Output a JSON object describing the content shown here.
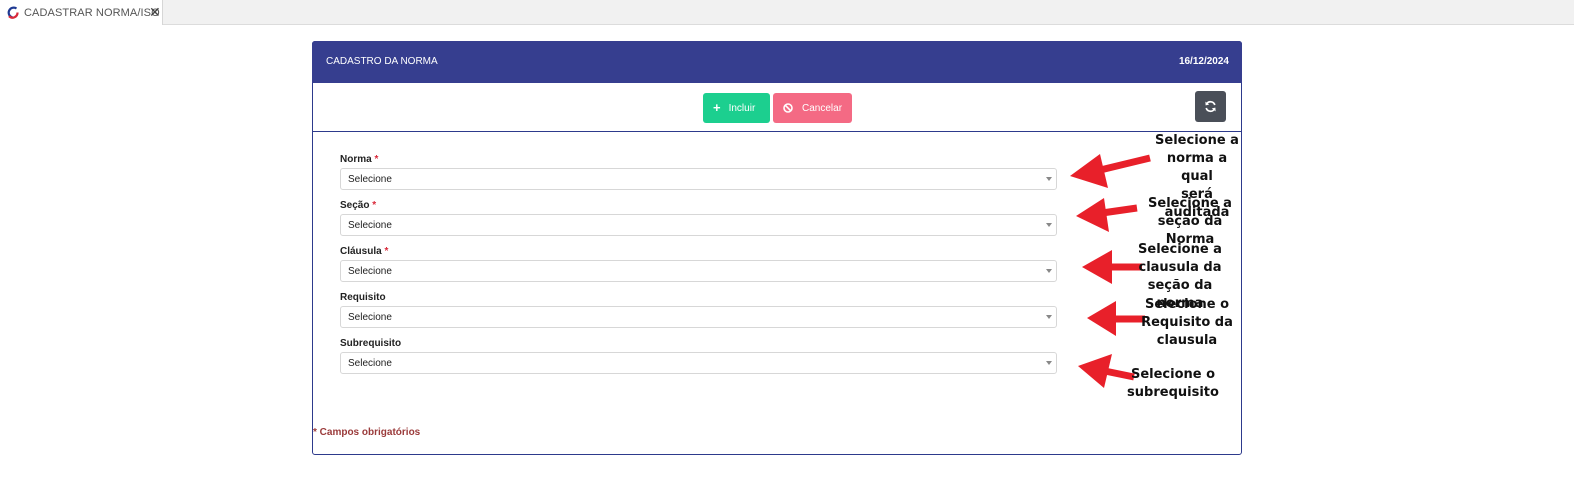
{
  "tab": {
    "title": "CADASTRAR NORMA/ISO",
    "close_symbol": "✕",
    "logo_icon": "app-logo-icon"
  },
  "panel": {
    "title": "CADASTRO DA NORMA",
    "date": "16/12/2024"
  },
  "toolbar": {
    "incluir_label": "Incluir",
    "incluir_icon": "plus-icon",
    "cancelar_label": "Cancelar",
    "cancelar_icon": "ban-icon",
    "refresh_icon": "refresh-icon",
    "incluir_color": "#1ccf8f",
    "cancelar_color": "#f46a84",
    "refresh_color": "#4a4f58"
  },
  "form": {
    "fields": [
      {
        "label": "Norma",
        "required": "*",
        "value": "Selecione"
      },
      {
        "label": "Seção",
        "required": "*",
        "value": "Selecione"
      },
      {
        "label": "Cláusula",
        "required": "*",
        "value": "Selecione"
      },
      {
        "label": "Requisito",
        "required": "",
        "value": "Selecione"
      },
      {
        "label": "Subrequisito",
        "required": "",
        "value": "Selecione"
      }
    ],
    "required_note": "* Campos obrigatórios"
  },
  "annotations": [
    "Selecione a\nnorma a qual\nserá auditada",
    "Selecione a\nseção da Norma",
    "Selecione a\nclausula da\nseção da norma",
    "Selecione o\nRequisito da\nclausula",
    "Selecione o\nsubrequisito"
  ],
  "colors": {
    "header": "#363e8f",
    "border": "#2d3a8c",
    "arrow": "#e8202a"
  }
}
